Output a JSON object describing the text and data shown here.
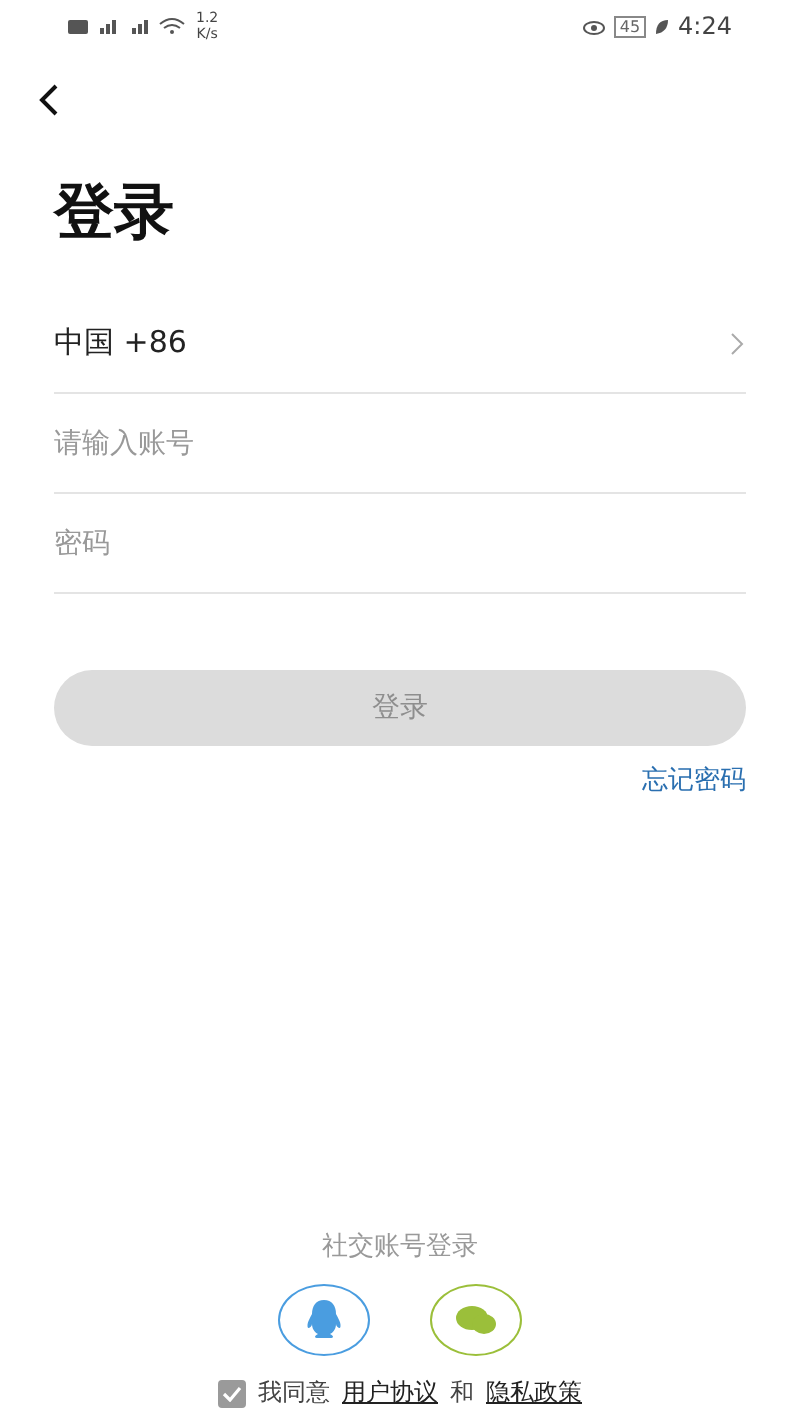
{
  "status_bar": {
    "speed": "1.2",
    "speed_unit": "K/s",
    "battery": "45",
    "time": "4:24"
  },
  "title": "登录",
  "fields": [
    {
      "kind": "select",
      "value": "中国 +86"
    },
    {
      "kind": "text",
      "placeholder": "请输入账号"
    },
    {
      "kind": "password",
      "placeholder": "密码"
    }
  ],
  "login_button": {
    "label": "登录",
    "disabled": true
  },
  "forgot_link": "忘记密码",
  "social": {
    "title": "社交账号登录",
    "items": [
      {
        "kind": "qq",
        "color": "#4a9de0"
      },
      {
        "kind": "wechat",
        "color": "#9bbf3a"
      }
    ]
  },
  "agreement": {
    "checked": true,
    "prefix": "我同意",
    "links": [
      "用户协议",
      "隐私政策"
    ],
    "joiner": "和"
  }
}
